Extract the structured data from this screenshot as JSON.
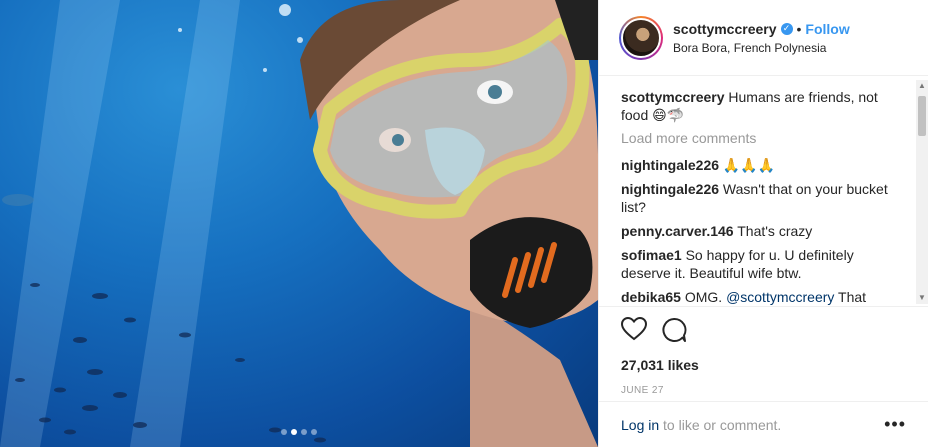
{
  "post": {
    "username": "scottymccreery",
    "verified_icon": "verified-check-icon",
    "separator": "•",
    "follow_label": "Follow",
    "location": "Bora Bora, French Polynesia",
    "carousel": {
      "total": 4,
      "active_index": 1
    }
  },
  "comments": {
    "caption": {
      "user": "scottymccreery",
      "text": "Humans are friends, not food 😄🦈"
    },
    "load_more": "Load more comments",
    "items": [
      {
        "user": "nightingale226",
        "text": "🙏🙏🙏"
      },
      {
        "user": "nightingale226",
        "text": "Wasn't that on your bucket list?"
      },
      {
        "user": "penny.carver.146",
        "text": "That's crazy"
      },
      {
        "user": "sofimae1",
        "text": "So happy for u. U definitely deserve it. Beautiful wife btw."
      },
      {
        "user": "debika65",
        "text": "OMG.",
        "mention": "@scottymccreery",
        "tail": "That"
      }
    ]
  },
  "actions": {
    "like_icon": "heart-icon",
    "comment_icon": "comment-bubble-icon",
    "likes": "27,031 likes",
    "date": "JUNE 27"
  },
  "footer": {
    "login_label": "Log in",
    "rest": " to like or comment.",
    "more_label": "•••"
  },
  "colors": {
    "accent": "#3897f0",
    "link": "#003569",
    "muted": "#999999"
  }
}
